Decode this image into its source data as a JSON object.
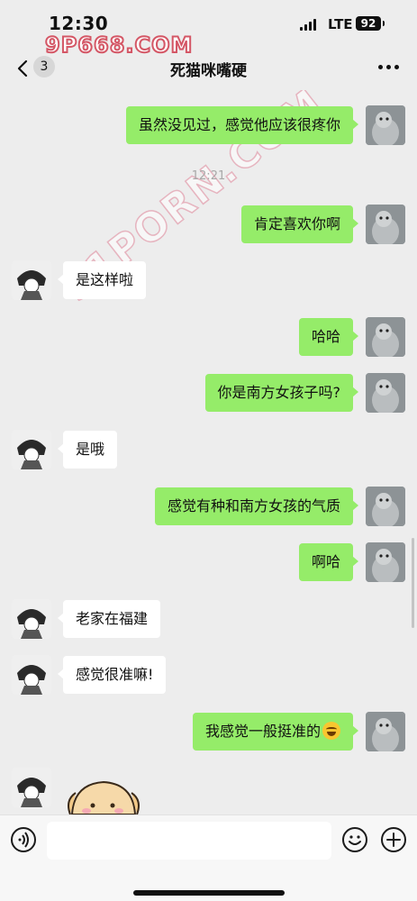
{
  "status_bar": {
    "time": "12:30",
    "network": "LTE",
    "battery": "92"
  },
  "watermarks": {
    "top": "9P668.COM",
    "diagonal": "91PORN.COM"
  },
  "nav": {
    "back_count": "3",
    "title": "死猫咪嘴硬",
    "back_icon": "chevron-left-icon",
    "more_icon": "more-dots-icon"
  },
  "messages": [
    {
      "sender": "me",
      "text": "虽然没见过，感觉他应该很疼你"
    },
    {
      "sender": "me",
      "text": "肯定喜欢你啊"
    },
    {
      "sender": "other",
      "text": "是这样啦"
    },
    {
      "sender": "me",
      "text": "哈哈"
    },
    {
      "sender": "me",
      "text": "你是南方女孩子吗?"
    },
    {
      "sender": "other",
      "text": "是哦"
    },
    {
      "sender": "me",
      "text": "感觉有种和南方女孩的气质"
    },
    {
      "sender": "me",
      "text": "啊哈"
    },
    {
      "sender": "other",
      "text": "老家在福建"
    },
    {
      "sender": "other",
      "text": "感觉很准嘛!"
    },
    {
      "sender": "me",
      "text": "我感觉一般挺准的",
      "emoji": "tears-of-joy-emoji"
    },
    {
      "sender": "other",
      "sticker": "puppy-sticker"
    }
  ],
  "timestamp": "12:21",
  "input_bar": {
    "placeholder": "",
    "voice_icon": "voice-icon",
    "emoji_icon": "smiley-icon",
    "plus_icon": "plus-icon"
  },
  "colors": {
    "my_bubble": "#95ec69",
    "other_bubble": "#ffffff",
    "background": "#ededed",
    "watermark": "#d45766"
  }
}
